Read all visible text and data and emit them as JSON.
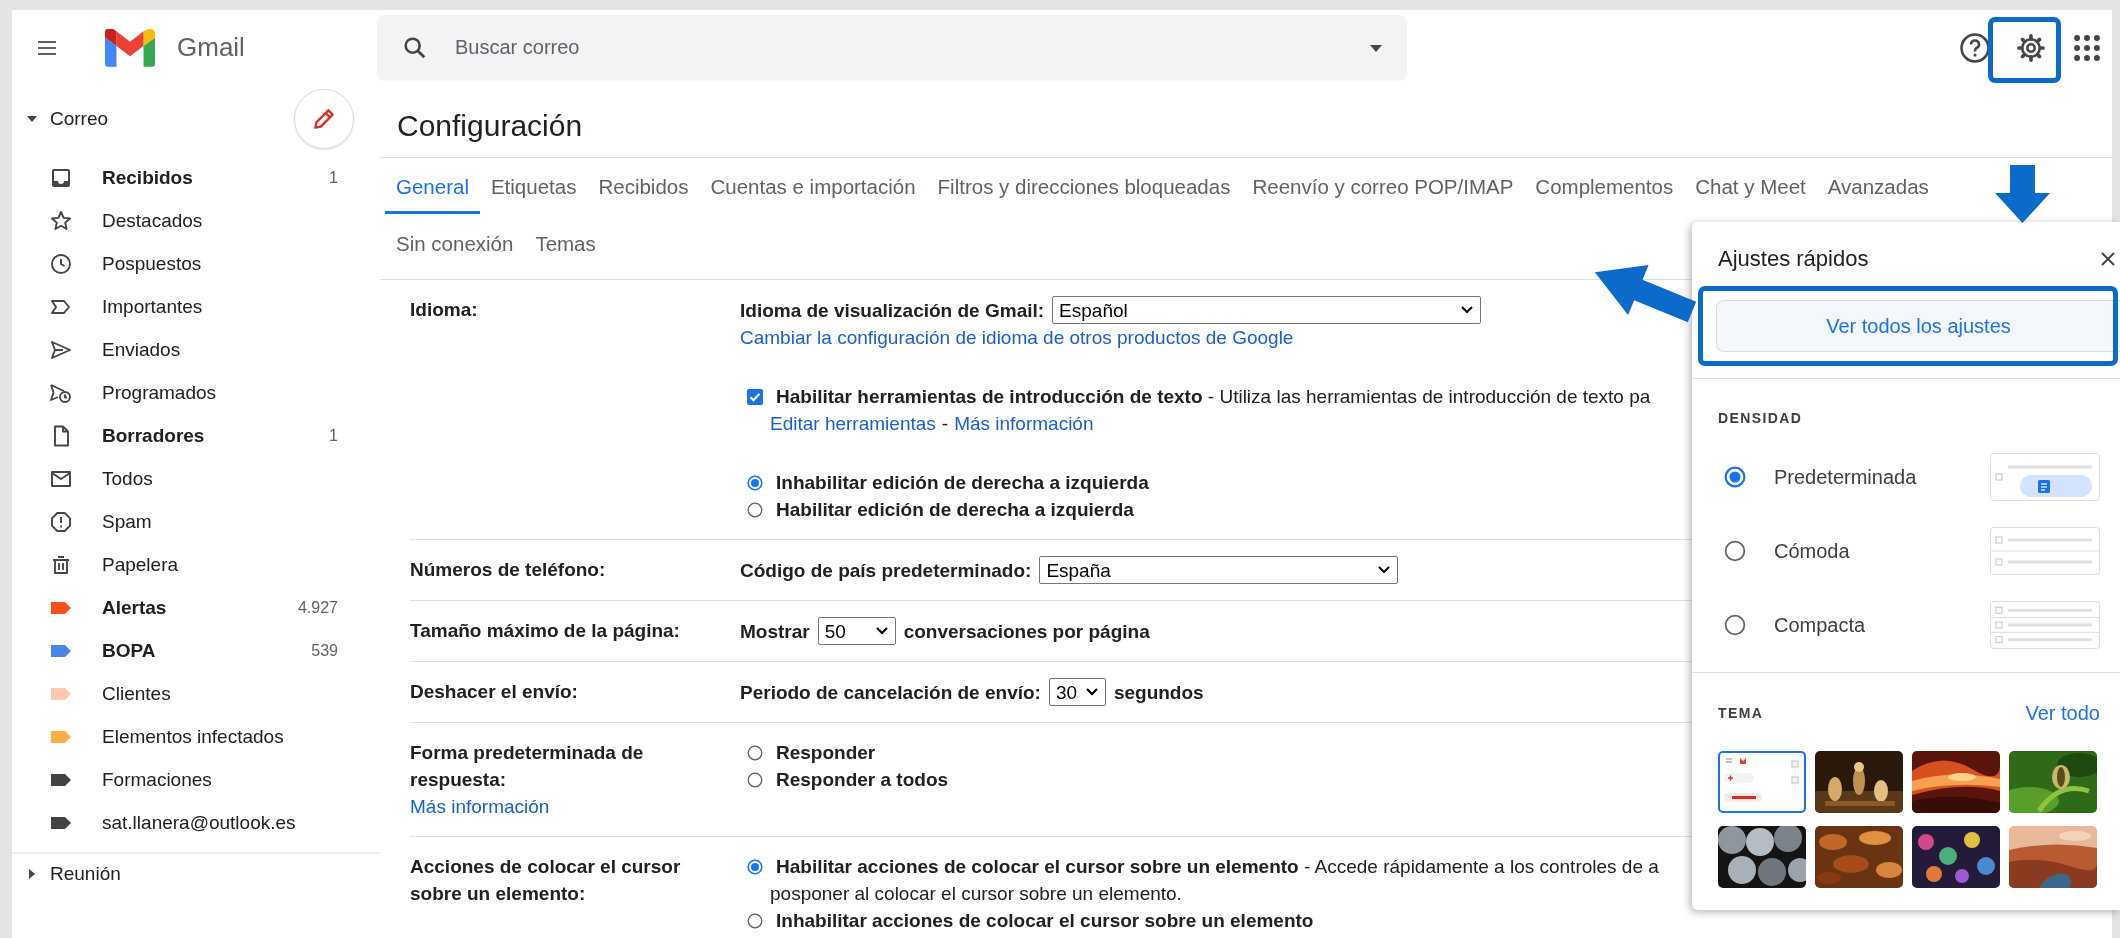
{
  "header": {
    "app_name": "Gmail",
    "search": {
      "placeholder": "Buscar correo"
    }
  },
  "sidebar": {
    "section": {
      "label": "Correo",
      "expanded": true
    },
    "items": [
      {
        "kind": "inbox",
        "label": "Recibidos",
        "count": "1",
        "unread": true
      },
      {
        "kind": "star",
        "label": "Destacados",
        "unread": false
      },
      {
        "kind": "clock",
        "label": "Pospuestos",
        "unread": false
      },
      {
        "kind": "important",
        "label": "Importantes",
        "unread": false
      },
      {
        "kind": "send",
        "label": "Enviados",
        "unread": false
      },
      {
        "kind": "scheduled",
        "label": "Programados",
        "unread": false
      },
      {
        "kind": "draft",
        "label": "Borradores",
        "count": "1",
        "unread": true
      },
      {
        "kind": "mail",
        "label": "Todos",
        "unread": false
      },
      {
        "kind": "spam",
        "label": "Spam",
        "unread": false
      },
      {
        "kind": "trash",
        "label": "Papelera",
        "unread": false
      },
      {
        "kind": "label",
        "label": "Alertas",
        "count": "4.927",
        "unread": true,
        "color": "#f4511e"
      },
      {
        "kind": "label",
        "label": "BOPA",
        "count": "539",
        "unread": true,
        "color": "#4a86e8"
      },
      {
        "kind": "label",
        "label": "Clientes",
        "unread": false,
        "color": "#ffc8af"
      },
      {
        "kind": "label",
        "label": "Elementos infectados",
        "unread": false,
        "color": "#ffad47"
      },
      {
        "kind": "label",
        "label": "Formaciones",
        "unread": false,
        "color": "#434343"
      },
      {
        "kind": "label",
        "label": "sat.llanera@outlook.es",
        "unread": false,
        "color": "#434343"
      }
    ],
    "footer_section": {
      "label": "Reunión",
      "expanded": false
    }
  },
  "page": {
    "title": "Configuración",
    "tabs": [
      {
        "label": "General",
        "selected": true
      },
      {
        "label": "Etiquetas",
        "selected": false
      },
      {
        "label": "Recibidos",
        "selected": false
      },
      {
        "label": "Cuentas e importación",
        "selected": false
      },
      {
        "label": "Filtros y direcciones bloqueadas",
        "selected": false
      },
      {
        "label": "Reenvío y correo POP/IMAP",
        "selected": false
      },
      {
        "label": "Complementos",
        "selected": false
      },
      {
        "label": "Chat y Meet",
        "selected": false
      },
      {
        "label": "Avanzadas",
        "selected": false
      },
      {
        "label": "Sin conexión",
        "selected": false
      },
      {
        "label": "Temas",
        "selected": false
      }
    ],
    "settings": [
      {
        "label": "Idioma:",
        "groups": [
          [
            {
              "kind": "select",
              "prefix": "Idioma de visualización de Gmail:",
              "value": "Español"
            },
            {
              "kind": "link",
              "text": "Cambiar la configuración de idioma de otros productos de Google"
            }
          ],
          [
            {
              "kind": "checkbox",
              "checked": true,
              "title": "Habilitar herramientas de introducción de texto",
              "desc": "- Utiliza las herramientas de introducción de texto pa"
            },
            {
              "kind": "links",
              "links": [
                "Editar herramientas",
                "Más información"
              ],
              "separator": "-"
            }
          ],
          [
            {
              "kind": "radio",
              "selected": true,
              "title": "Inhabilitar edición de derecha a izquierda"
            },
            {
              "kind": "radio",
              "selected": false,
              "title": "Habilitar edición de derecha a izquierda"
            }
          ]
        ]
      },
      {
        "label": "Números de teléfono:",
        "groups": [
          [
            {
              "kind": "select",
              "prefix": "Código de país predeterminado:",
              "value": "España"
            }
          ]
        ]
      },
      {
        "label": "Tamaño máximo de la página:",
        "groups": [
          [
            {
              "kind": "select",
              "prefix": "Mostrar",
              "value": "50",
              "suffix": "conversaciones por página"
            }
          ]
        ]
      },
      {
        "label": "Deshacer el envío:",
        "groups": [
          [
            {
              "kind": "select",
              "prefix": "Periodo de cancelación de envío:",
              "value": "30",
              "suffix": "segundos"
            }
          ]
        ]
      },
      {
        "label": "Forma predeterminada de respuesta:",
        "label_link": "Más información",
        "groups": [
          [
            {
              "kind": "radio",
              "selected": false,
              "title": "Responder"
            },
            {
              "kind": "radio",
              "selected": false,
              "title": "Responder a todos"
            }
          ]
        ]
      },
      {
        "label": "Acciones de colocar el cursor sobre un elemento:",
        "groups": [
          [
            {
              "kind": "radio",
              "selected": true,
              "title": "Habilitar acciones de colocar el cursor sobre un elemento",
              "desc": "- Accede rápidamente a los controles de a"
            },
            {
              "kind": "text",
              "text": "posponer al colocar el cursor sobre un elemento."
            },
            {
              "kind": "radio",
              "selected": false,
              "title": "Inhabilitar acciones de colocar el cursor sobre un elemento"
            }
          ]
        ]
      }
    ]
  },
  "quick_settings": {
    "title": "Ajustes rápidos",
    "button": "Ver todos los ajustes",
    "density": {
      "heading": "DENSIDAD",
      "options": [
        {
          "label": "Predeterminada",
          "selected": true
        },
        {
          "label": "Cómoda",
          "selected": false
        },
        {
          "label": "Compacta",
          "selected": false
        }
      ]
    },
    "theme": {
      "heading": "TEMA",
      "link": "Ver todo",
      "thumbnails": [
        {
          "kind": "default",
          "selected": true
        },
        {
          "kind": "picture",
          "selected": false
        },
        {
          "kind": "picture",
          "selected": false
        },
        {
          "kind": "picture",
          "selected": false
        },
        {
          "kind": "picture",
          "selected": false
        },
        {
          "kind": "picture",
          "selected": false
        },
        {
          "kind": "picture",
          "selected": false
        },
        {
          "kind": "picture",
          "selected": false
        }
      ]
    }
  }
}
